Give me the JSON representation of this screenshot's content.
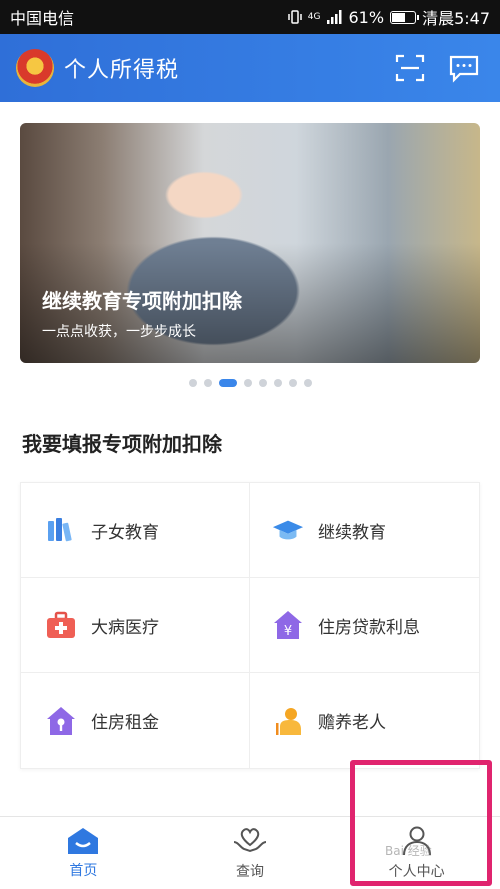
{
  "status_bar": {
    "carrier": "中国电信",
    "signal": "4G",
    "battery_percent": "61%",
    "time": "清晨5:47",
    "battery_level": 0.61
  },
  "header": {
    "title": "个人所得税",
    "scan_icon": "scan-icon",
    "message_icon": "message-icon"
  },
  "banner": {
    "title": "继续教育专项附加扣除",
    "subtitle": "一点点收获，一步步成长",
    "page_count": 8,
    "active_index": 2
  },
  "section": {
    "title": "我要填报专项附加扣除"
  },
  "deductions": [
    {
      "label": "子女教育",
      "icon": "books-icon"
    },
    {
      "label": "继续教育",
      "icon": "graduation-cap-icon"
    },
    {
      "label": "大病医疗",
      "icon": "medical-kit-icon"
    },
    {
      "label": "住房贷款利息",
      "icon": "house-yuan-icon"
    },
    {
      "label": "住房租金",
      "icon": "house-key-icon"
    },
    {
      "label": "赡养老人",
      "icon": "elderly-icon"
    }
  ],
  "nav": [
    {
      "label": "首页",
      "icon": "home-icon",
      "active": true
    },
    {
      "label": "查询",
      "icon": "heart-hand-icon",
      "active": false
    },
    {
      "label": "个人中心",
      "icon": "person-icon",
      "active": false
    }
  ],
  "colors": {
    "brand": "#2f78e0",
    "highlight": "#e0246e"
  },
  "watermark": "Bai 经验"
}
